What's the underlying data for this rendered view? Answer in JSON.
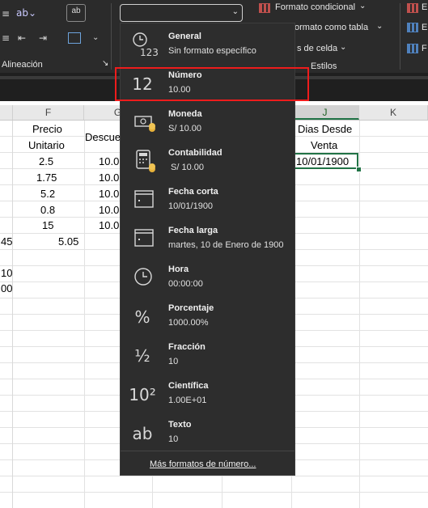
{
  "ribbon": {
    "alineacion_label": "Alineación",
    "wrap_icon_text": "ab",
    "alineacion_launcher": "↘",
    "conditional_format_label": "Formato condicional",
    "format_as_table_label": "ormato como tabla",
    "cell_styles_label": "s de celda",
    "styles_group_label": "Estilos",
    "right_items": [
      "E",
      "E",
      "F"
    ],
    "number_format_value": ""
  },
  "sheet": {
    "columns": [
      "F",
      "G",
      "J",
      "K"
    ],
    "selected_column": "J",
    "headers": {
      "F_line1": "Precio",
      "F_line2": "Unitario",
      "G_partial": "Descue",
      "J_line1": "Dias Desde",
      "J_line2": "Venta"
    },
    "F_values": [
      "2.5",
      "1.75",
      "5.2",
      "0.8",
      "15"
    ],
    "G_partial_values": [
      "10.0",
      "10.0",
      "10.0",
      "10.0",
      "10.0"
    ],
    "row7_edge": "45",
    "row7_F": "5.05",
    "row9_edge": "10",
    "row10_edge": "00",
    "selected_cell_value": "10/01/1900"
  },
  "dropdown": {
    "items": [
      {
        "title": "General",
        "subtitle": "Sin formato específico",
        "icon": "clock-123-icon"
      },
      {
        "title": "Número",
        "subtitle": "10.00",
        "icon": "number-12-icon",
        "icon_text": "12"
      },
      {
        "title": "Moneda",
        "subtitle": "S/ 10.00",
        "icon": "currency-icon"
      },
      {
        "title": "Contabilidad",
        "subtitle": " S/ 10.00",
        "icon": "calculator-icon"
      },
      {
        "title": "Fecha corta",
        "subtitle": "10/01/1900",
        "icon": "calendar-short-icon"
      },
      {
        "title": "Fecha larga",
        "subtitle": "martes, 10 de Enero de 1900",
        "icon": "calendar-long-icon"
      },
      {
        "title": "Hora",
        "subtitle": "00:00:00",
        "icon": "clock-icon"
      },
      {
        "title": "Porcentaje",
        "subtitle": "1000.00%",
        "icon": "percent-icon",
        "icon_text": "%"
      },
      {
        "title": "Fracción",
        "subtitle": "10",
        "icon": "fraction-icon",
        "icon_text": "½"
      },
      {
        "title": "Científica",
        "subtitle": "1.00E+01",
        "icon": "scientific-icon",
        "icon_text": "10²"
      },
      {
        "title": "Texto",
        "subtitle": "10",
        "icon": "text-ab-icon",
        "icon_text": "ab"
      }
    ],
    "footer_link": "Más formatos de número...",
    "highlighted_item": "Número"
  },
  "colors": {
    "ribbon_bg": "#2b2b2b",
    "menu_bg": "#2d2d2d",
    "highlight": "#ee1c1c",
    "selection": "#217346"
  }
}
